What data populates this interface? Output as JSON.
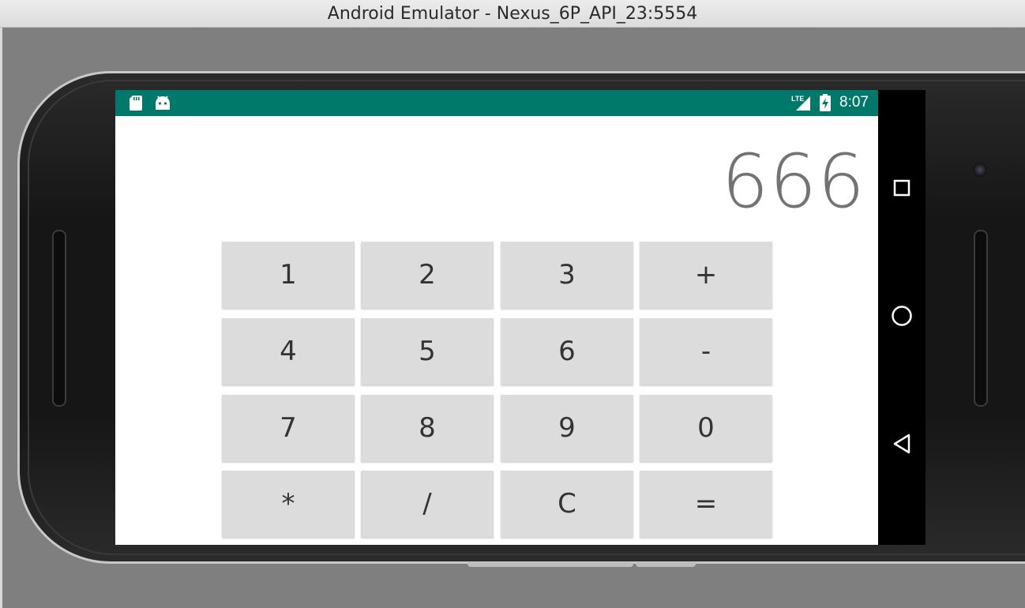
{
  "window": {
    "title": "Android Emulator - Nexus_6P_API_23:5554"
  },
  "status_bar": {
    "time": "8:07",
    "network": "LTE",
    "icons": [
      "sd-card-icon",
      "android-icon",
      "lte-signal-icon",
      "battery-charging-icon"
    ],
    "color": "#00796b"
  },
  "calculator": {
    "display": "666",
    "keys": [
      [
        "1",
        "2",
        "3",
        "+"
      ],
      [
        "4",
        "5",
        "6",
        "-"
      ],
      [
        "7",
        "8",
        "9",
        "0"
      ],
      [
        "*",
        "/",
        "C",
        "="
      ]
    ]
  },
  "nav_bar": {
    "buttons": [
      "overview-icon",
      "home-icon",
      "back-icon"
    ]
  }
}
